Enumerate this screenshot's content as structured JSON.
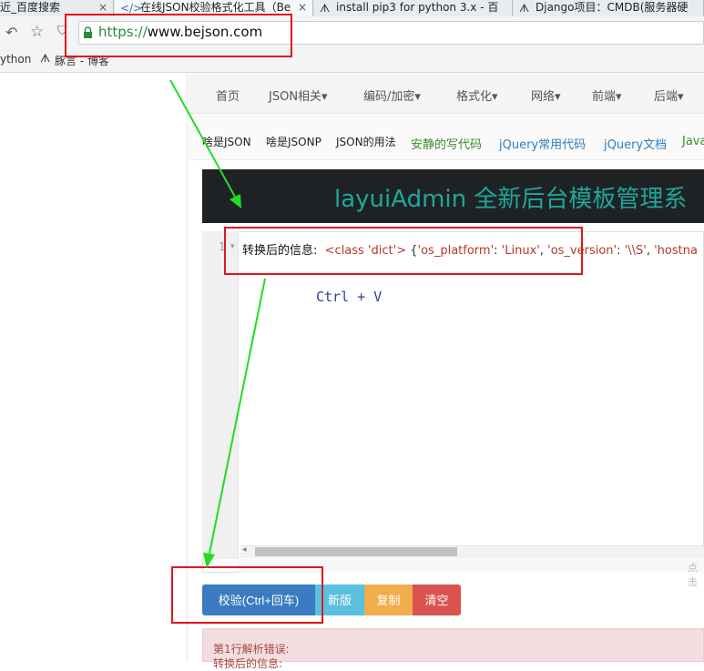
{
  "browser": {
    "tabs": [
      {
        "label": "近_百度搜索",
        "active": false,
        "icon": "none"
      },
      {
        "label": "在线JSON校验格式化工具（Be",
        "active": true,
        "icon": "code-icon"
      },
      {
        "label": "install pip3 for python 3.x - 百",
        "active": false,
        "icon": "wolf-icon"
      },
      {
        "label": "Django项目：CMDB(服务器硬",
        "active": false,
        "icon": "wolf-icon"
      }
    ],
    "close_glyph": "×",
    "url_scheme": "https://",
    "url_host": "www.bejson.com",
    "bookmarks": [
      "ython",
      "豚言 - 博客"
    ]
  },
  "nav": {
    "items": [
      "首页",
      "JSON相关▾",
      "编码/加密▾",
      "格式化▾",
      "网络▾",
      "前端▾",
      "后端▾"
    ]
  },
  "links": [
    {
      "label": "啥是JSON",
      "color": "#222222"
    },
    {
      "label": "啥是JSONP",
      "color": "#222222"
    },
    {
      "label": "JSON的用法",
      "color": "#222222"
    },
    {
      "label": "安静的写代码",
      "color": "#3c8a2e"
    },
    {
      "label": "jQuery常用代码",
      "color": "#2f7ec0"
    },
    {
      "label": "jQuery文档",
      "color": "#2f7ec0"
    },
    {
      "label": "Java",
      "color": "#3c8a2e"
    }
  ],
  "banner": {
    "text": "layuiAdmin 全新后台模板管理系"
  },
  "editor": {
    "line_number": "1",
    "fold_glyph": "▾",
    "prefix": "转换后的信息:",
    "tag_open": "<class 'dict'>",
    "brace": "{",
    "k1": "'os_platform'",
    "v1": "'Linux'",
    "k2": "'os_version'",
    "v2": "'\\\\S'",
    "k3": "'hostna",
    "hint": "Ctrl + V",
    "scroll_left_glyph": "◂",
    "status_text": "点击"
  },
  "buttons": {
    "validate": "校验(Ctrl+回车)",
    "new_version": "新版",
    "copy": "复制",
    "clear": "清空"
  },
  "error": {
    "title": "第1行解析错误:",
    "detail": "转换后的信息:"
  }
}
